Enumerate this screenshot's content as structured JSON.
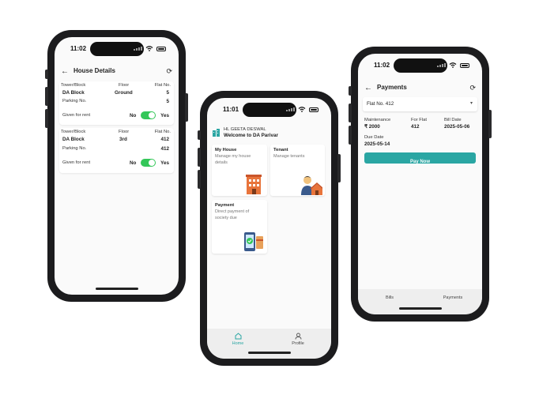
{
  "phone_left": {
    "status_time": "11:02",
    "title": "House Details",
    "cards": [
      {
        "tower_label": "Tower/Block",
        "floor_label": "Floor",
        "flat_label": "Flat No.",
        "tower": "DA Block",
        "floor": "Ground",
        "flat": "5",
        "parking_label": "Parking No.",
        "parking": "5",
        "rent_label": "Given for rent",
        "no": "No",
        "yes": "Yes"
      },
      {
        "tower_label": "Tower/Block",
        "floor_label": "Floor",
        "flat_label": "Flat No.",
        "tower": "DA Block",
        "floor": "3rd",
        "flat": "412",
        "parking_label": "Parking No.",
        "parking": "412",
        "rent_label": "Given for rent",
        "no": "No",
        "yes": "Yes"
      }
    ]
  },
  "phone_center": {
    "status_time": "11:01",
    "user_name": "HL GEETA DESWAL",
    "welcome": "Welcome to DA Parivar",
    "tiles": [
      {
        "title": "My House",
        "desc": "Manage my house details"
      },
      {
        "title": "Tenant",
        "desc": "Manage tenants"
      },
      {
        "title": "Payment",
        "desc": "Direct payment of society due"
      }
    ],
    "tabs": [
      {
        "label": "Home",
        "icon": "home-icon",
        "active": true
      },
      {
        "label": "Profile",
        "icon": "person-icon",
        "active": false
      }
    ]
  },
  "phone_right": {
    "status_time": "11:02",
    "title": "Payments",
    "flat_select": "Flat No. 412",
    "maintenance_label": "Maintenance",
    "maintenance_value": "₹ 2000",
    "for_flat_label": "For Flat",
    "for_flat_value": "412",
    "bill_date_label": "Bill Date",
    "bill_date_value": "2025-05-06",
    "due_date_label": "Due Date",
    "due_date_value": "2025-05-14",
    "pay_button": "Pay Now",
    "tabs": [
      {
        "label": "Bills"
      },
      {
        "label": "Payments"
      }
    ]
  },
  "colors": {
    "accent": "#2aa6a3",
    "toggle_on": "#34c759",
    "tab_active": "#2aa6a3"
  }
}
